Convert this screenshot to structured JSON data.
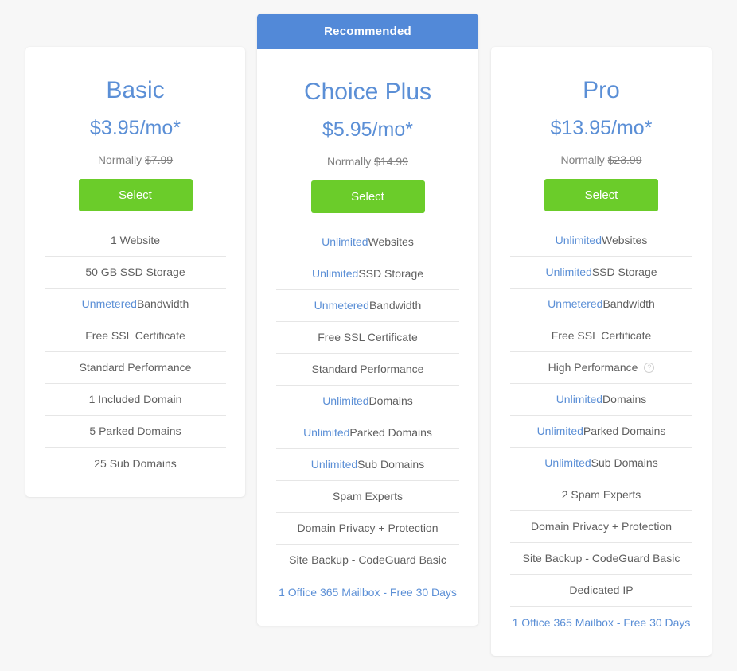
{
  "plans": [
    {
      "name": "Basic",
      "price": "$3.95/mo*",
      "normally_label": "Normally",
      "normally_price": "$7.99",
      "select_label": "Select",
      "recommended": false,
      "badge_label": "",
      "features": [
        {
          "highlight": "",
          "text": "1 Website",
          "accent": false,
          "help": false
        },
        {
          "highlight": "",
          "text": "50 GB SSD Storage",
          "accent": false,
          "help": false
        },
        {
          "highlight": "Unmetered",
          "text": " Bandwidth",
          "accent": false,
          "help": false
        },
        {
          "highlight": "",
          "text": "Free SSL Certificate",
          "accent": false,
          "help": false
        },
        {
          "highlight": "",
          "text": "Standard Performance",
          "accent": false,
          "help": false
        },
        {
          "highlight": "",
          "text": "1 Included Domain",
          "accent": false,
          "help": false
        },
        {
          "highlight": "",
          "text": "5 Parked Domains",
          "accent": false,
          "help": false
        },
        {
          "highlight": "",
          "text": "25 Sub Domains",
          "accent": false,
          "help": false
        }
      ]
    },
    {
      "name": "Choice Plus",
      "price": "$5.95/mo*",
      "normally_label": "Normally",
      "normally_price": "$14.99",
      "select_label": "Select",
      "recommended": true,
      "badge_label": "Recommended",
      "features": [
        {
          "highlight": "Unlimited",
          "text": " Websites",
          "accent": false,
          "help": false
        },
        {
          "highlight": "Unlimited",
          "text": " SSD Storage",
          "accent": false,
          "help": false
        },
        {
          "highlight": "Unmetered",
          "text": " Bandwidth",
          "accent": false,
          "help": false
        },
        {
          "highlight": "",
          "text": "Free SSL Certificate",
          "accent": false,
          "help": false
        },
        {
          "highlight": "",
          "text": "Standard Performance",
          "accent": false,
          "help": false
        },
        {
          "highlight": "Unlimited",
          "text": " Domains",
          "accent": false,
          "help": false
        },
        {
          "highlight": "Unlimited",
          "text": " Parked Domains",
          "accent": false,
          "help": false
        },
        {
          "highlight": "Unlimited",
          "text": " Sub Domains",
          "accent": false,
          "help": false
        },
        {
          "highlight": "",
          "text": "Spam Experts",
          "accent": false,
          "help": false
        },
        {
          "highlight": "",
          "text": "Domain Privacy + Protection",
          "accent": false,
          "help": false
        },
        {
          "highlight": "",
          "text": "Site Backup - CodeGuard Basic",
          "accent": false,
          "help": false
        },
        {
          "highlight": "",
          "text": "1 Office 365 Mailbox - Free 30 Days",
          "accent": true,
          "help": false
        }
      ]
    },
    {
      "name": "Pro",
      "price": "$13.95/mo*",
      "normally_label": "Normally",
      "normally_price": "$23.99",
      "select_label": "Select",
      "recommended": false,
      "badge_label": "",
      "features": [
        {
          "highlight": "Unlimited",
          "text": " Websites",
          "accent": false,
          "help": false
        },
        {
          "highlight": "Unlimited",
          "text": " SSD Storage",
          "accent": false,
          "help": false
        },
        {
          "highlight": "Unmetered",
          "text": " Bandwidth",
          "accent": false,
          "help": false
        },
        {
          "highlight": "",
          "text": "Free SSL Certificate",
          "accent": false,
          "help": false
        },
        {
          "highlight": "",
          "text": "High Performance",
          "accent": false,
          "help": true
        },
        {
          "highlight": "Unlimited",
          "text": " Domains",
          "accent": false,
          "help": false
        },
        {
          "highlight": "Unlimited",
          "text": " Parked Domains",
          "accent": false,
          "help": false
        },
        {
          "highlight": "Unlimited",
          "text": " Sub Domains",
          "accent": false,
          "help": false
        },
        {
          "highlight": "",
          "text": "2 Spam Experts",
          "accent": false,
          "help": false
        },
        {
          "highlight": "",
          "text": "Domain Privacy + Protection",
          "accent": false,
          "help": false
        },
        {
          "highlight": "",
          "text": "Site Backup - CodeGuard Basic",
          "accent": false,
          "help": false
        },
        {
          "highlight": "",
          "text": "Dedicated IP",
          "accent": false,
          "help": false
        },
        {
          "highlight": "",
          "text": "1 Office 365 Mailbox - Free 30 Days",
          "accent": true,
          "help": false
        }
      ]
    }
  ],
  "icons": {
    "help": "?"
  },
  "colors": {
    "accent_blue": "#5b8fd6",
    "badge_blue": "#5289d8",
    "select_green": "#6bcc2a",
    "page_background": "#f7f7f7",
    "card_background": "#ffffff",
    "divider": "#e6e6e6",
    "body_text": "#5f5f5f",
    "muted_text": "#808080"
  }
}
